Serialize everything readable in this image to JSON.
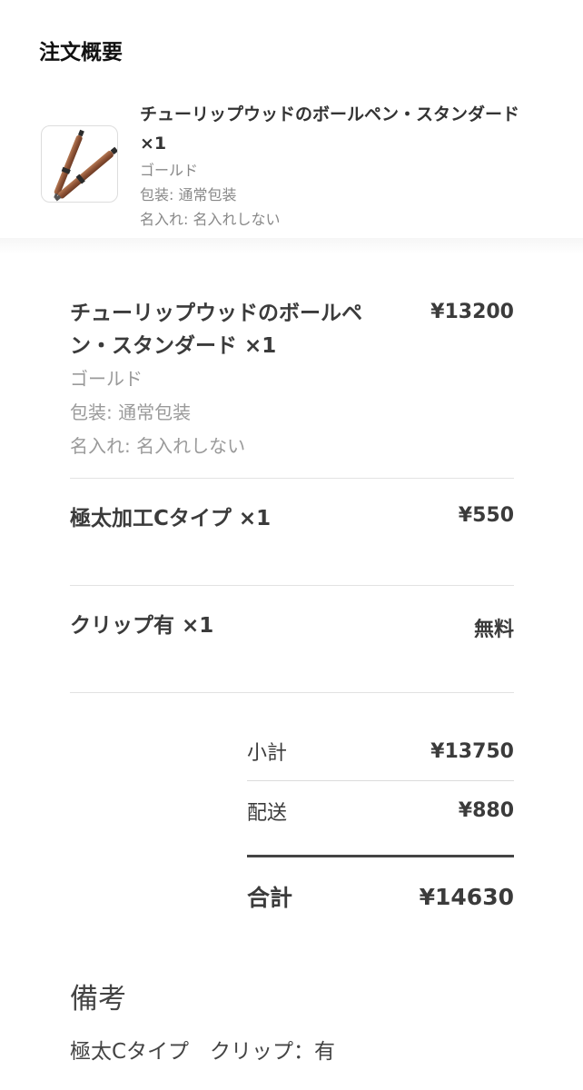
{
  "summary": {
    "title": "注文概要",
    "item": {
      "image_icon": "ballpoint-pen-product-image",
      "name": "チューリップウッドのボールペン・スタンダード ×1",
      "variant": "ゴールド",
      "wrapping": "包装: 通常包装",
      "engraving": "名入れ: 名入れしない"
    }
  },
  "line_items": [
    {
      "name": "チューリップウッドのボールペン・スタンダード ×1",
      "price": "¥13200",
      "variant": "ゴールド",
      "wrapping": "包装: 通常包装",
      "engraving": "名入れ: 名入れしない"
    },
    {
      "name": "極太加工Cタイプ ×1",
      "price": "¥550"
    },
    {
      "name": "クリップ有 ×1",
      "price": "無料"
    }
  ],
  "totals": {
    "subtotal_label": "小計",
    "subtotal_value": "¥13750",
    "shipping_label": "配送",
    "shipping_value": "¥880",
    "total_label": "合計",
    "total_value": "¥14630"
  },
  "notes": {
    "title": "備考",
    "body": "極太Cタイプ　クリップ：有"
  }
}
